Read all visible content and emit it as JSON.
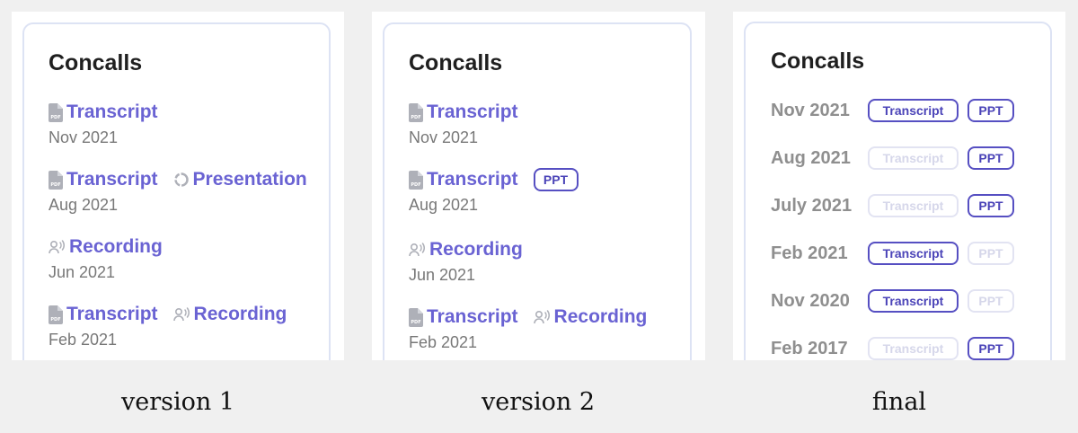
{
  "version1": {
    "title": "Concalls",
    "caption": "version 1",
    "entries": [
      {
        "link1": "Transcript",
        "date": "Nov 2021"
      },
      {
        "link1": "Transcript",
        "link2": "Presentation",
        "date": "Aug 2021"
      },
      {
        "link1": "Recording",
        "date": "Jun 2021"
      },
      {
        "link1": "Transcript",
        "link2": "Recording",
        "date": "Feb 2021"
      }
    ]
  },
  "version2": {
    "title": "Concalls",
    "caption": "version 2",
    "entries": [
      {
        "link1": "Transcript",
        "date": "Nov 2021"
      },
      {
        "link1": "Transcript",
        "pill": "PPT",
        "date": "Aug 2021"
      },
      {
        "link1": "Recording",
        "date": "Jun 2021"
      },
      {
        "link1": "Transcript",
        "link2": "Recording",
        "date": "Feb 2021"
      }
    ]
  },
  "final": {
    "title": "Concalls",
    "caption": "final",
    "transcript_label": "Transcript",
    "ppt_label": "PPT",
    "rows": [
      {
        "date": "Nov 2021",
        "transcript_available": true,
        "ppt_available": true
      },
      {
        "date": "Aug 2021",
        "transcript_available": false,
        "ppt_available": true
      },
      {
        "date": "July 2021",
        "transcript_available": false,
        "ppt_available": true
      },
      {
        "date": "Feb 2021",
        "transcript_available": true,
        "ppt_available": false
      },
      {
        "date": "Nov 2020",
        "transcript_available": true,
        "ppt_available": false
      },
      {
        "date": "Feb 2017",
        "transcript_available": false,
        "ppt_available": true
      }
    ]
  },
  "colors": {
    "link": "#6a63d3",
    "pill_active": "#564fc2",
    "pill_inactive": "#e2e3f2",
    "date": "#787878",
    "background": "#f0f0f0"
  }
}
